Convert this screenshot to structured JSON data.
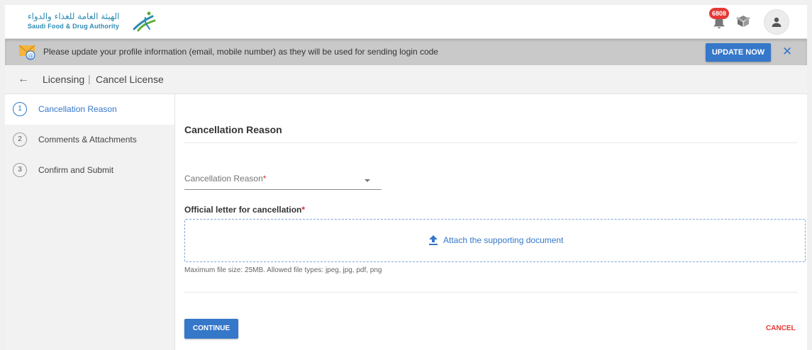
{
  "header": {
    "logo_arabic": "الهيئة العامة للغذاء والدواء",
    "logo_english": "Saudi Food & Drug Authority",
    "notification_count": "6808"
  },
  "banner": {
    "message": "Please update your profile information (email, mobile number) as they will be used for sending login code",
    "update_label": "UPDATE NOW",
    "close_glyph": "✕"
  },
  "breadcrumb": {
    "back_glyph": "←",
    "section": "Licensing",
    "separator": "|",
    "page": "Cancel License"
  },
  "steps": [
    {
      "number": "1",
      "label": "Cancellation Reason",
      "active": true
    },
    {
      "number": "2",
      "label": "Comments & Attachments",
      "active": false
    },
    {
      "number": "3",
      "label": "Confirm and Submit",
      "active": false
    }
  ],
  "form": {
    "section_title": "Cancellation Reason",
    "reason_placeholder": "Cancellation Reason",
    "required_mark": "*",
    "file_label": "Official letter for cancellation",
    "attach_text": "Attach the supporting document",
    "file_hint": "Maximum file size: 25MB. Allowed file types: jpeg, jpg, pdf, png"
  },
  "actions": {
    "continue_label": "CONTINUE",
    "cancel_label": "CANCEL"
  },
  "colors": {
    "primary": "#3577c9",
    "danger": "#e53935",
    "banner_bg": "#c9c9c9"
  },
  "icons": [
    "sfda-logo-icon",
    "bell-icon",
    "package-icon",
    "user-icon",
    "mail-icon",
    "back-arrow-icon",
    "close-icon",
    "chevron-down-icon",
    "upload-icon"
  ]
}
